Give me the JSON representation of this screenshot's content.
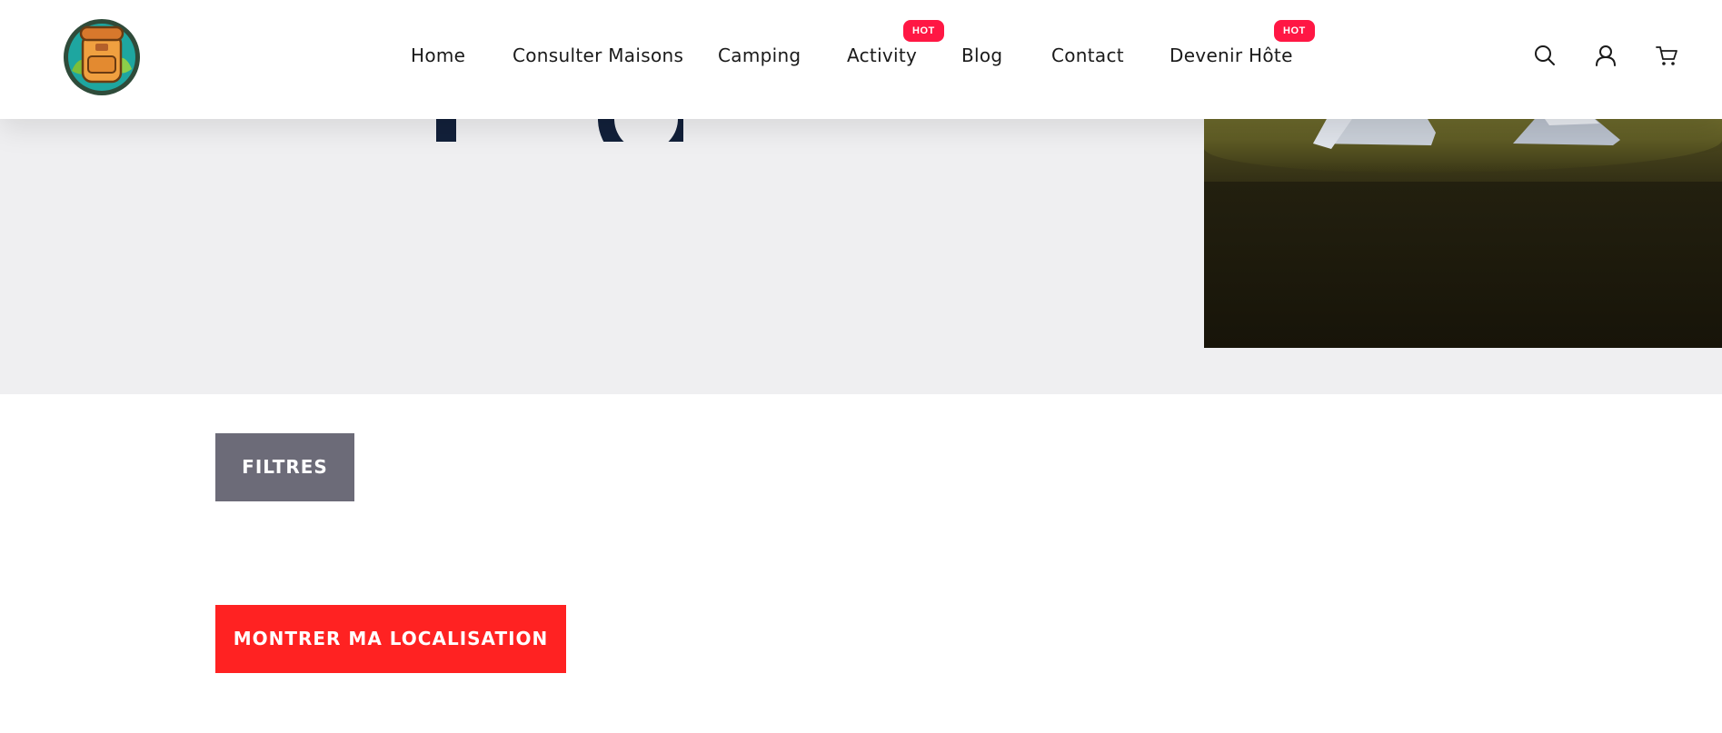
{
  "header": {
    "logo_name": "backpack-logo",
    "nav": [
      {
        "label": "Home",
        "hot": false
      },
      {
        "label": "Consulter Maisons",
        "hot": false
      },
      {
        "label": "Camping",
        "hot": false
      },
      {
        "label": "Activity",
        "hot": true
      },
      {
        "label": "Blog",
        "hot": false
      },
      {
        "label": "Contact",
        "hot": false
      },
      {
        "label": "Devenir Hôte",
        "hot": true
      }
    ],
    "hot_label": "HOT",
    "icons": [
      "search-icon",
      "user-icon",
      "cart-icon"
    ]
  },
  "hero": {
    "image": "camping-tents-photo"
  },
  "filters_button": "FILTRES",
  "location_button": "MONTRER MA LOCALISATION",
  "colors": {
    "hot_badge": "#ff1744",
    "filters_button": "#6c6b78",
    "location_button": "#ff2222",
    "hero_background": "#efeff1",
    "title_text": "#12203a"
  }
}
